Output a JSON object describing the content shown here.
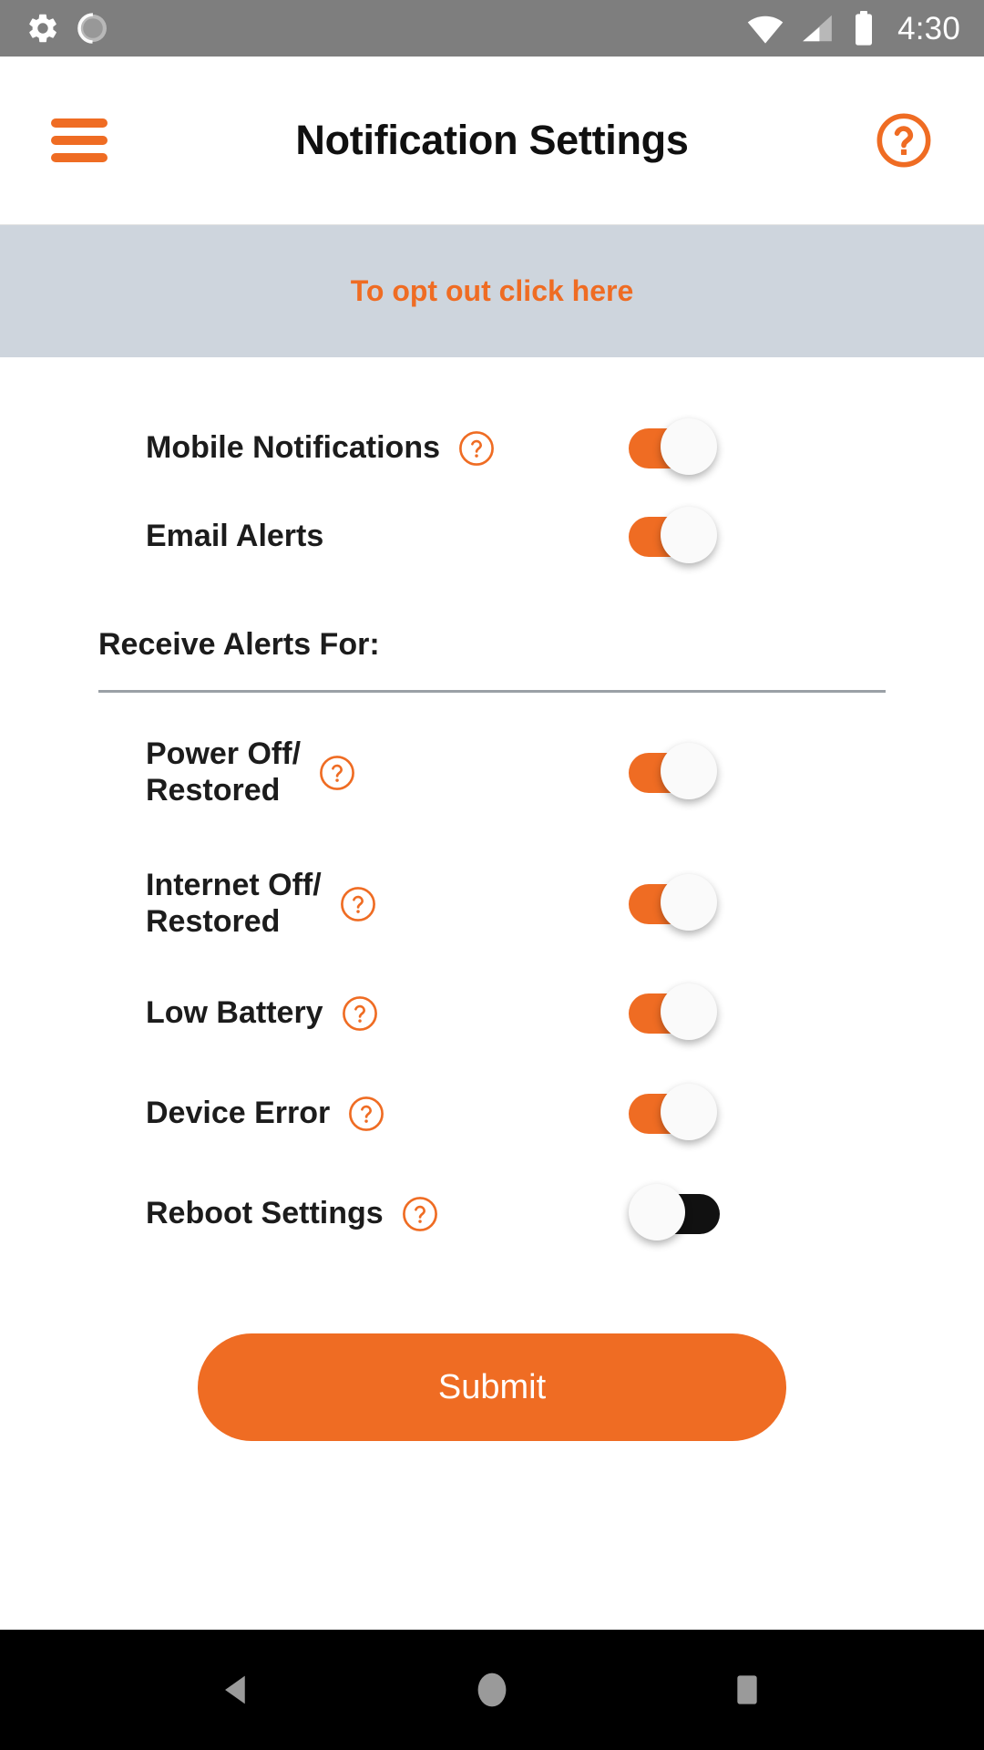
{
  "status_bar": {
    "left_icons": [
      "gear-icon",
      "sync-progress-icon"
    ],
    "right_icons": [
      "wifi-icon",
      "cellular-signal-icon",
      "battery-icon"
    ],
    "time": "4:30",
    "background_color": "#7e7e7e"
  },
  "app_bar": {
    "menu_icon": "hamburger-menu-icon",
    "title": "Notification Settings",
    "help_icon": "help-circle-icon",
    "accent_color": "#ef6c23"
  },
  "opt_out_banner": {
    "text": "To opt out click here",
    "background_color": "#ced5dd",
    "text_color": "#ef6c23"
  },
  "primary_settings": [
    {
      "label": "Mobile Notifications",
      "has_help": true,
      "toggle": "on"
    },
    {
      "label": "Email Alerts",
      "has_help": false,
      "toggle": "on"
    }
  ],
  "alerts_section": {
    "heading": "Receive Alerts For:",
    "items": [
      {
        "label": "Power Off/\nRestored",
        "has_help": true,
        "toggle": "on",
        "two_line": true
      },
      {
        "label": "Internet Off/\nRestored",
        "has_help": true,
        "toggle": "on",
        "two_line": true
      },
      {
        "label": "Low Battery",
        "has_help": true,
        "toggle": "on",
        "two_line": false
      },
      {
        "label": "Device Error",
        "has_help": true,
        "toggle": "on",
        "two_line": false
      },
      {
        "label": "Reboot Settings",
        "has_help": true,
        "toggle": "off",
        "two_line": false
      }
    ]
  },
  "submit": {
    "label": "Submit",
    "background_color": "#ef6c23",
    "text_color": "#ffffff"
  },
  "nav_bar": {
    "back_icon": "back-triangle-icon",
    "home_icon": "home-circle-icon",
    "recents_icon": "recents-square-icon",
    "background_color": "#000000",
    "icon_color": "#9a9a9a"
  }
}
